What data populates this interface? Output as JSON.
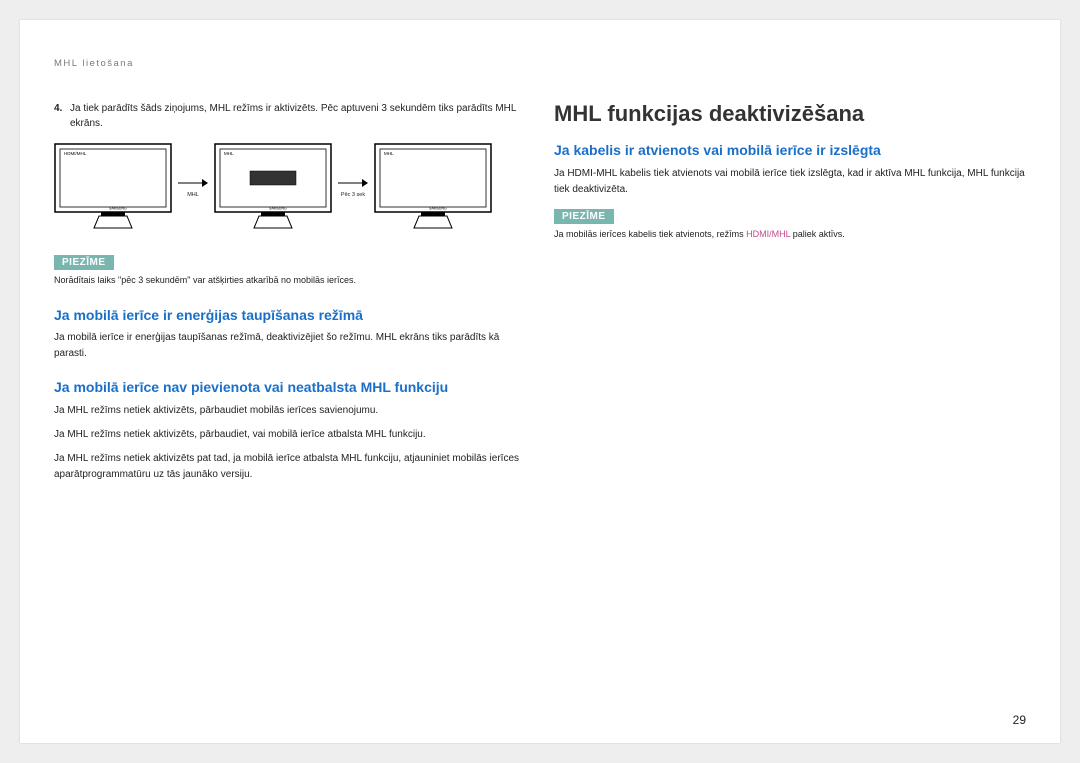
{
  "breadcrumb": "MHL lietošana",
  "left": {
    "listNum": "4.",
    "listText": "Ja tiek parādīts šāds ziņojums, MHL režīms ir aktivizēts. Pēc aptuveni 3 sekundēm tiks parādīts MHL ekrāns.",
    "diagram": {
      "label1": "HDMI/MHL",
      "label2": "MHL",
      "label3": "MHL",
      "arrow1": "MHL",
      "arrow2": "Pēc 3 sek"
    },
    "noteBadge": "PIEZĪME",
    "noteText": "Norādītais laiks \"pēc 3 sekundēm\" var atšķirties atkarībā no mobilās ierīces.",
    "h2a": "Ja mobilā ierīce ir enerģijas taupīšanas režīmā",
    "p2a": "Ja mobilā ierīce ir enerģijas taupīšanas režīmā, deaktivizējiet šo režīmu. MHL ekrāns tiks parādīts kā parasti.",
    "h2b": "Ja mobilā ierīce nav pievienota vai neatbalsta MHL funkciju",
    "p2b1": "Ja MHL režīms netiek aktivizēts, pārbaudiet mobilās ierīces savienojumu.",
    "p2b2": "Ja MHL režīms netiek aktivizēts, pārbaudiet, vai mobilā ierīce atbalsta MHL funkciju.",
    "p2b3": "Ja MHL režīms netiek aktivizēts pat tad, ja mobilā ierīce atbalsta MHL funkciju, atjauniniet mobilās ierīces aparātprogrammatūru uz tās jaunāko versiju."
  },
  "right": {
    "h1": "MHL funkcijas deaktivizēšana",
    "h2": "Ja kabelis ir atvienots vai mobilā ierīce ir izslēgta",
    "p1": "Ja HDMI-MHL kabelis tiek atvienots vai mobilā ierīce tiek izslēgta, kad ir aktīva MHL funkcija, MHL funkcija tiek deaktivizēta.",
    "noteBadge": "PIEZĪME",
    "noteTextPre": "Ja mobilās ierīces kabelis tiek atvienots, režīms ",
    "notePink": "HDMI/MHL",
    "noteTextPost": " paliek aktīvs."
  },
  "pageNum": "29"
}
